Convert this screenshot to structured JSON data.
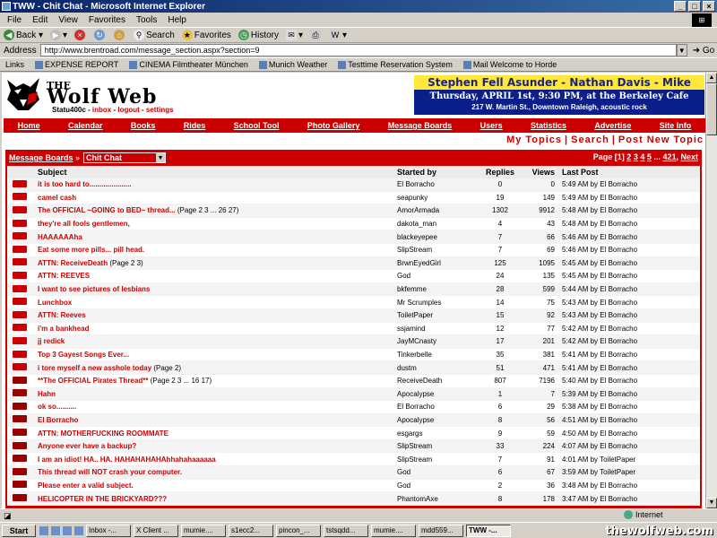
{
  "window": {
    "title": "TWW - Chit Chat - Microsoft Internet Explorer"
  },
  "menu": [
    "File",
    "Edit",
    "View",
    "Favorites",
    "Tools",
    "Help"
  ],
  "toolbar": {
    "back": "Back",
    "search": "Search",
    "favorites": "Favorites",
    "history": "History"
  },
  "address": {
    "label": "Address",
    "url": "http://www.brentroad.com/message_section.aspx?section=9",
    "go": "Go"
  },
  "links": {
    "label": "Links",
    "items": [
      "EXPENSE REPORT",
      "CINEMA Filmtheater München",
      "Munich Weather",
      "Testtime Reservation System",
      "Mail",
      "Welcome to Horde"
    ]
  },
  "site": {
    "logo_the": "THE",
    "logo_name": "Wolf Web",
    "user": "Statu400c",
    "user_links": [
      "inbox",
      "logout",
      "settings"
    ],
    "ad": {
      "line1": "Stephen Fell Asunder - Nathan Davis - Mike Garrigan",
      "line2": "Thursday, APRIL 1st, 9:30 PM, at the Berkeley Cafe",
      "line3": "217 W. Martin St., Downtown Raleigh, acoustic rock"
    },
    "nav": [
      "Home",
      "Calendar",
      "Books",
      "Rides",
      "School Tool",
      "Photo Gallery",
      "Message Boards",
      "Users",
      "Statistics",
      "Advertise",
      "Site Info"
    ],
    "subnav": [
      "My Topics",
      "Search",
      "Post New Topic"
    ]
  },
  "board": {
    "breadcrumb": "Message Boards",
    "section": "Chit Chat",
    "pager": {
      "prefix": "Page",
      "current": "[1]",
      "pages": [
        "2",
        "3",
        "4",
        "5"
      ],
      "ellipsis": "...",
      "last": "421",
      "next": "Next"
    },
    "columns": {
      "subject": "Subject",
      "started_by": "Started by",
      "replies": "Replies",
      "views": "Views",
      "last_post": "Last Post"
    },
    "threads": [
      {
        "subject": "it is too hard to.....................",
        "pages": "",
        "by": "El Borracho",
        "replies": "0",
        "views": "0",
        "last": "5:49 AM by El Borracho",
        "hot": false
      },
      {
        "subject": "camel cash",
        "pages": "",
        "by": "seapunky",
        "replies": "19",
        "views": "149",
        "last": "5:49 AM by El Borracho",
        "hot": false
      },
      {
        "subject": "The OFFICIAL ~GOING to BED~ thread...",
        "pages": "(Page 2 3 ... 26 27)",
        "by": "AmorArmada",
        "replies": "1302",
        "views": "9912",
        "last": "5:48 AM by El Borracho",
        "hot": false
      },
      {
        "subject": "they're all fools gentlemen,",
        "pages": "",
        "by": "dakota_man",
        "replies": "4",
        "views": "43",
        "last": "5:48 AM by El Borracho",
        "hot": false
      },
      {
        "subject": "HAAAAAAha",
        "pages": "",
        "by": "blackeyepee",
        "replies": "7",
        "views": "66",
        "last": "5:46 AM by El Borracho",
        "hot": false
      },
      {
        "subject": "Eat some more pills... pill head.",
        "pages": "",
        "by": "SlipStream",
        "replies": "7",
        "views": "69",
        "last": "5:46 AM by El Borracho",
        "hot": false
      },
      {
        "subject": "ATTN: ReceiveDeath",
        "pages": "(Page 2 3)",
        "by": "BrwnEyedGirl",
        "replies": "125",
        "views": "1095",
        "last": "5:45 AM by El Borracho",
        "hot": false
      },
      {
        "subject": "ATTN: REEVES",
        "pages": "",
        "by": "God",
        "replies": "24",
        "views": "135",
        "last": "5:45 AM by El Borracho",
        "hot": false
      },
      {
        "subject": "I want to see pictures of lesbians",
        "pages": "",
        "by": "bkfemme",
        "replies": "28",
        "views": "599",
        "last": "5:44 AM by El Borracho",
        "hot": false
      },
      {
        "subject": "Lunchbox",
        "pages": "",
        "by": "Mr Scrumples",
        "replies": "14",
        "views": "75",
        "last": "5:43 AM by El Borracho",
        "hot": false
      },
      {
        "subject": "ATTN: Reeves",
        "pages": "",
        "by": "ToiletPaper",
        "replies": "15",
        "views": "92",
        "last": "5:43 AM by El Borracho",
        "hot": false
      },
      {
        "subject": "i'm a bankhead",
        "pages": "",
        "by": "ssjamind",
        "replies": "12",
        "views": "77",
        "last": "5:42 AM by El Borracho",
        "hot": false
      },
      {
        "subject": "jj redick",
        "pages": "",
        "by": "JayMCnasty",
        "replies": "17",
        "views": "201",
        "last": "5:42 AM by El Borracho",
        "hot": false
      },
      {
        "subject": "Top 3 Gayest Songs Ever...",
        "pages": "",
        "by": "Tinkerbelle",
        "replies": "35",
        "views": "381",
        "last": "5:41 AM by El Borracho",
        "hot": false
      },
      {
        "subject": "i tore myself a new asshole today",
        "pages": "(Page 2)",
        "by": "dustm",
        "replies": "51",
        "views": "471",
        "last": "5:41 AM by El Borracho",
        "hot": false
      },
      {
        "subject": "**The OFFICIAL Pirates Thread**",
        "pages": "(Page 2 3 ... 16 17)",
        "by": "ReceiveDeath",
        "replies": "807",
        "views": "7196",
        "last": "5:40 AM by El Borracho",
        "hot": true
      },
      {
        "subject": "Hahn",
        "pages": "",
        "by": "Apocalypse",
        "replies": "1",
        "views": "7",
        "last": "5:39 AM by El Borracho",
        "hot": true
      },
      {
        "subject": "ok so..........",
        "pages": "",
        "by": "El Borracho",
        "replies": "6",
        "views": "29",
        "last": "5:38 AM by El Borracho",
        "hot": true
      },
      {
        "subject": "El Borracho",
        "pages": "",
        "by": "Apocalypse",
        "replies": "8",
        "views": "56",
        "last": "4:51 AM by El Borracho",
        "hot": true
      },
      {
        "subject": "ATTN: MOTHERFUCKING ROOMMATE",
        "pages": "",
        "by": "esgargs",
        "replies": "9",
        "views": "59",
        "last": "4:50 AM by El Borracho",
        "hot": true
      },
      {
        "subject": "Anyone ever have a backup?",
        "pages": "",
        "by": "SlipStream",
        "replies": "33",
        "views": "224",
        "last": "4:07 AM by El Borracho",
        "hot": true
      },
      {
        "subject": "I am an idiot! HA.. HA. HAHAHAHAHAhhahahaaaaaa",
        "pages": "",
        "by": "SlipStream",
        "replies": "7",
        "views": "91",
        "last": "4:01 AM by ToiletPaper",
        "hot": true
      },
      {
        "subject": "This thread will NOT crash your computer.",
        "pages": "",
        "by": "God",
        "replies": "6",
        "views": "67",
        "last": "3:59 AM by ToiletPaper",
        "hot": true
      },
      {
        "subject": "Please enter a valid subject.",
        "pages": "",
        "by": "God",
        "replies": "2",
        "views": "36",
        "last": "3:48 AM by El Borracho",
        "hot": true
      },
      {
        "subject": "HELICOPTER IN THE BRICKYARD???",
        "pages": "",
        "by": "PhantomAxe",
        "replies": "8",
        "views": "178",
        "last": "3:47 AM by El Borracho",
        "hot": true
      }
    ]
  },
  "status": {
    "zone": "Internet"
  },
  "taskbar": {
    "start": "Start",
    "tasks": [
      "Inbox -...",
      "X Client ...",
      "mumie....",
      "s1ecc2...",
      "pincon_...",
      "tstsqdd...",
      "mumie....",
      "mdd559...",
      "TWW -..."
    ]
  },
  "watermark": "thewolfweb.com"
}
